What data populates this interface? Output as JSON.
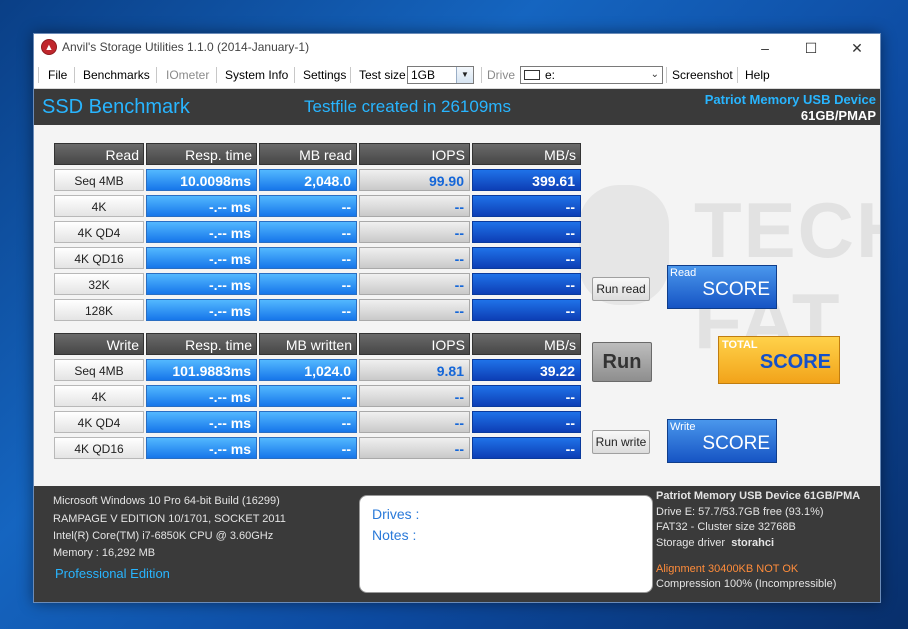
{
  "window": {
    "title": "Anvil's Storage Utilities 1.1.0 (2014-January-1)",
    "icon": "anvil-app-icon",
    "controls": {
      "minimize": "–",
      "maximize": "☐",
      "close": "✕"
    }
  },
  "menu": {
    "file": "File",
    "benchmarks": "Benchmarks",
    "iometer": "IOmeter",
    "system_info": "System Info",
    "settings": "Settings",
    "test_size_label": "Test size",
    "test_size_value": "1GB",
    "drive_label": "Drive",
    "drive_value": "e:",
    "screenshot": "Screenshot",
    "help": "Help"
  },
  "header": {
    "title": "SSD Benchmark",
    "testfile": "Testfile created in 26109ms",
    "device_name": "Patriot Memory USB Device",
    "device_size": "61GB/PMAP"
  },
  "read": {
    "headers": [
      "Read",
      "Resp. time",
      "MB read",
      "IOPS",
      "MB/s"
    ],
    "rows": [
      {
        "label": "Seq 4MB",
        "resp": "10.0098ms",
        "mb": "2,048.0",
        "iops": "99.90",
        "mbs": "399.61"
      },
      {
        "label": "4K",
        "resp": "-.-- ms",
        "mb": "--",
        "iops": "--",
        "mbs": "--"
      },
      {
        "label": "4K QD4",
        "resp": "-.-- ms",
        "mb": "--",
        "iops": "--",
        "mbs": "--"
      },
      {
        "label": "4K QD16",
        "resp": "-.-- ms",
        "mb": "--",
        "iops": "--",
        "mbs": "--"
      },
      {
        "label": "32K",
        "resp": "-.-- ms",
        "mb": "--",
        "iops": "--",
        "mbs": "--"
      },
      {
        "label": "128K",
        "resp": "-.-- ms",
        "mb": "--",
        "iops": "--",
        "mbs": "--"
      }
    ]
  },
  "write": {
    "headers": [
      "Write",
      "Resp. time",
      "MB written",
      "IOPS",
      "MB/s"
    ],
    "rows": [
      {
        "label": "Seq 4MB",
        "resp": "101.9883ms",
        "mb": "1,024.0",
        "iops": "9.81",
        "mbs": "39.22"
      },
      {
        "label": "4K",
        "resp": "-.-- ms",
        "mb": "--",
        "iops": "--",
        "mbs": "--"
      },
      {
        "label": "4K QD4",
        "resp": "-.-- ms",
        "mb": "--",
        "iops": "--",
        "mbs": "--"
      },
      {
        "label": "4K QD16",
        "resp": "-.-- ms",
        "mb": "--",
        "iops": "--",
        "mbs": "--"
      }
    ]
  },
  "actions": {
    "run_read": "Run read",
    "run": "Run",
    "run_write": "Run write"
  },
  "scores": {
    "read_label": "Read",
    "read_score": "SCORE",
    "write_label": "Write",
    "write_score": "SCORE",
    "total_label": "TOTAL",
    "total_score": "SCORE"
  },
  "watermark": "TECH FAT",
  "system": {
    "os": "Microsoft Windows 10 Pro 64-bit Build (16299)",
    "board": "RAMPAGE V EDITION 10/1701, SOCKET 2011",
    "cpu": "Intel(R) Core(TM) i7-6850K CPU @ 3.60GHz",
    "memory": "Memory : 16,292 MB",
    "edition": "Professional Edition"
  },
  "notes": {
    "drives": "Drives :",
    "notes": "Notes :"
  },
  "device": {
    "name": "Patriot Memory USB Device 61GB/PMA",
    "drive": "Drive E: 57.7/53.7GB free (93.1%)",
    "fs": "FAT32 - Cluster size 32768B",
    "driver_label": "Storage driver",
    "driver_value": "storahci",
    "alignment": "Alignment 30400KB NOT OK",
    "compression": "Compression 100% (Incompressible)"
  },
  "colors": {
    "accent": "#28b5ff",
    "warning": "#ff8c3a",
    "panel": "#3a3a3a"
  }
}
